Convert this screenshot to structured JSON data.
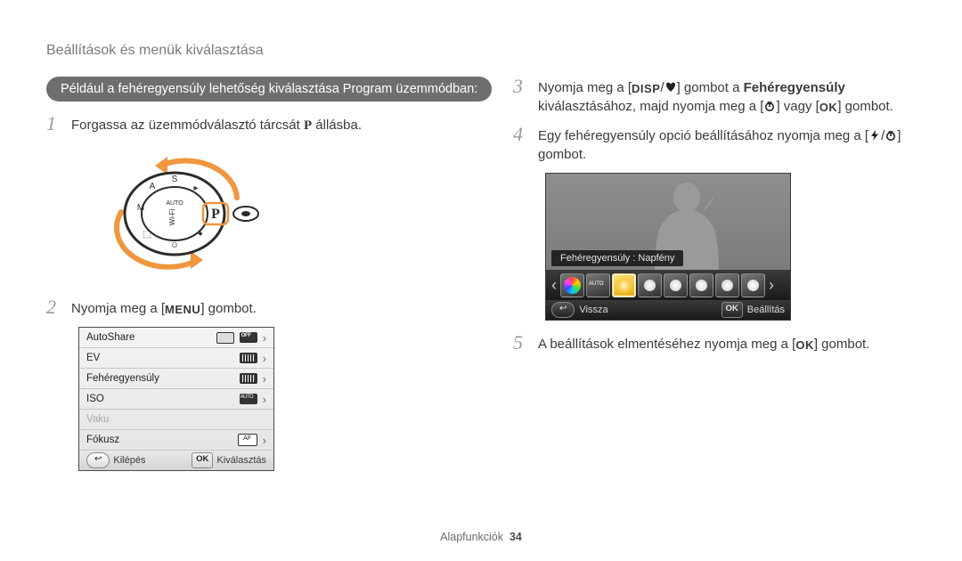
{
  "header": "Beállítások és menük kiválasztása",
  "example_bar": "Például a fehéregyensúly lehetőség kiválasztása Program üzemmódban:",
  "step1": {
    "num": "1",
    "pre": "Forgassa az üzemmódválasztó tárcsát ",
    "p": "P",
    "post": " állásba."
  },
  "step2": {
    "num": "2",
    "pre": "Nyomja meg a [",
    "menu": "MENU",
    "post": "] gombot."
  },
  "menu": {
    "items": [
      {
        "label": "AutoShare",
        "icon": "off"
      },
      {
        "label": "EV",
        "icon": "bars"
      },
      {
        "label": "Fehéregyensúly",
        "icon": "bars"
      },
      {
        "label": "ISO",
        "icon": "auto"
      },
      {
        "label": "Vaku",
        "icon": "",
        "disabled": true
      },
      {
        "label": "Fókusz",
        "icon": "af"
      }
    ],
    "footer_left": "Kilépés",
    "back_glyph": "↩",
    "footer_right_key": "OK",
    "footer_right": "Kiválasztás"
  },
  "step3": {
    "num": "3",
    "pre": "Nyomja meg a [",
    "disp": "DISP",
    "slash": "/",
    "mid": "] gombot a ",
    "bold": "Fehéregyensúly",
    "line2_a": "kiválasztásához, majd nyomja meg a [",
    "line2_mid": "] vagy [",
    "ok": "OK",
    "line2_b": "] gombot."
  },
  "step4": {
    "num": "4",
    "pre": "Egy fehéregyensúly opció beállításához nyomja meg a [",
    "slash": "/",
    "post": "] gombot."
  },
  "wb": {
    "label": "Fehéregyensúly : Napfény",
    "back_glyph": "↩",
    "back": "Vissza",
    "ok_key": "OK",
    "ok": "Beállítás",
    "nav_left": "‹",
    "nav_right": "›"
  },
  "step5": {
    "num": "5",
    "pre": "A beállítások elmentéséhez nyomja meg a [",
    "ok": "OK",
    "post": "] gombot."
  },
  "footer": {
    "section": "Alapfunkciók",
    "page": "34"
  }
}
